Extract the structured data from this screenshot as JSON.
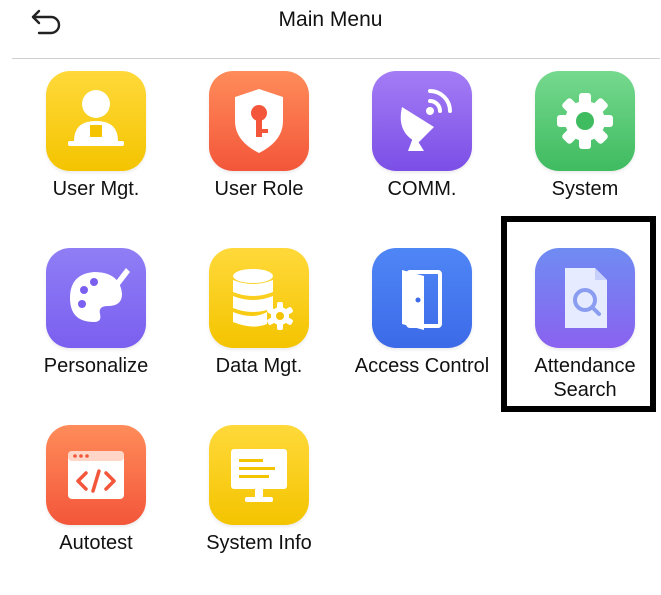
{
  "header": {
    "title": "Main Menu",
    "back_icon": "back-arrow-icon"
  },
  "menu": {
    "items": [
      {
        "label": "User Mgt.",
        "icon": "user-icon",
        "color": "#f4c400"
      },
      {
        "label": "User Role",
        "icon": "shield-key-icon",
        "color": "#f3563a"
      },
      {
        "label": "COMM.",
        "icon": "satellite-dish-icon",
        "color": "#7b4fe6"
      },
      {
        "label": "System",
        "icon": "gear-icon",
        "color": "#3fbb60"
      },
      {
        "label": "Personalize",
        "icon": "palette-icon",
        "color": "#7b5ff0"
      },
      {
        "label": "Data Mgt.",
        "icon": "database-gear-icon",
        "color": "#f4c400"
      },
      {
        "label": "Access Control",
        "icon": "door-icon",
        "color": "#3c6ae8"
      },
      {
        "label": "Attendance Search",
        "label_line1": "Attendance",
        "label_line2": "Search",
        "icon": "document-search-icon",
        "color": "#8a62f0",
        "highlighted": true
      },
      {
        "label": "Autotest",
        "icon": "code-window-icon",
        "color": "#f3563a"
      },
      {
        "label": "System Info",
        "icon": "monitor-icon",
        "color": "#f4c400"
      }
    ]
  }
}
